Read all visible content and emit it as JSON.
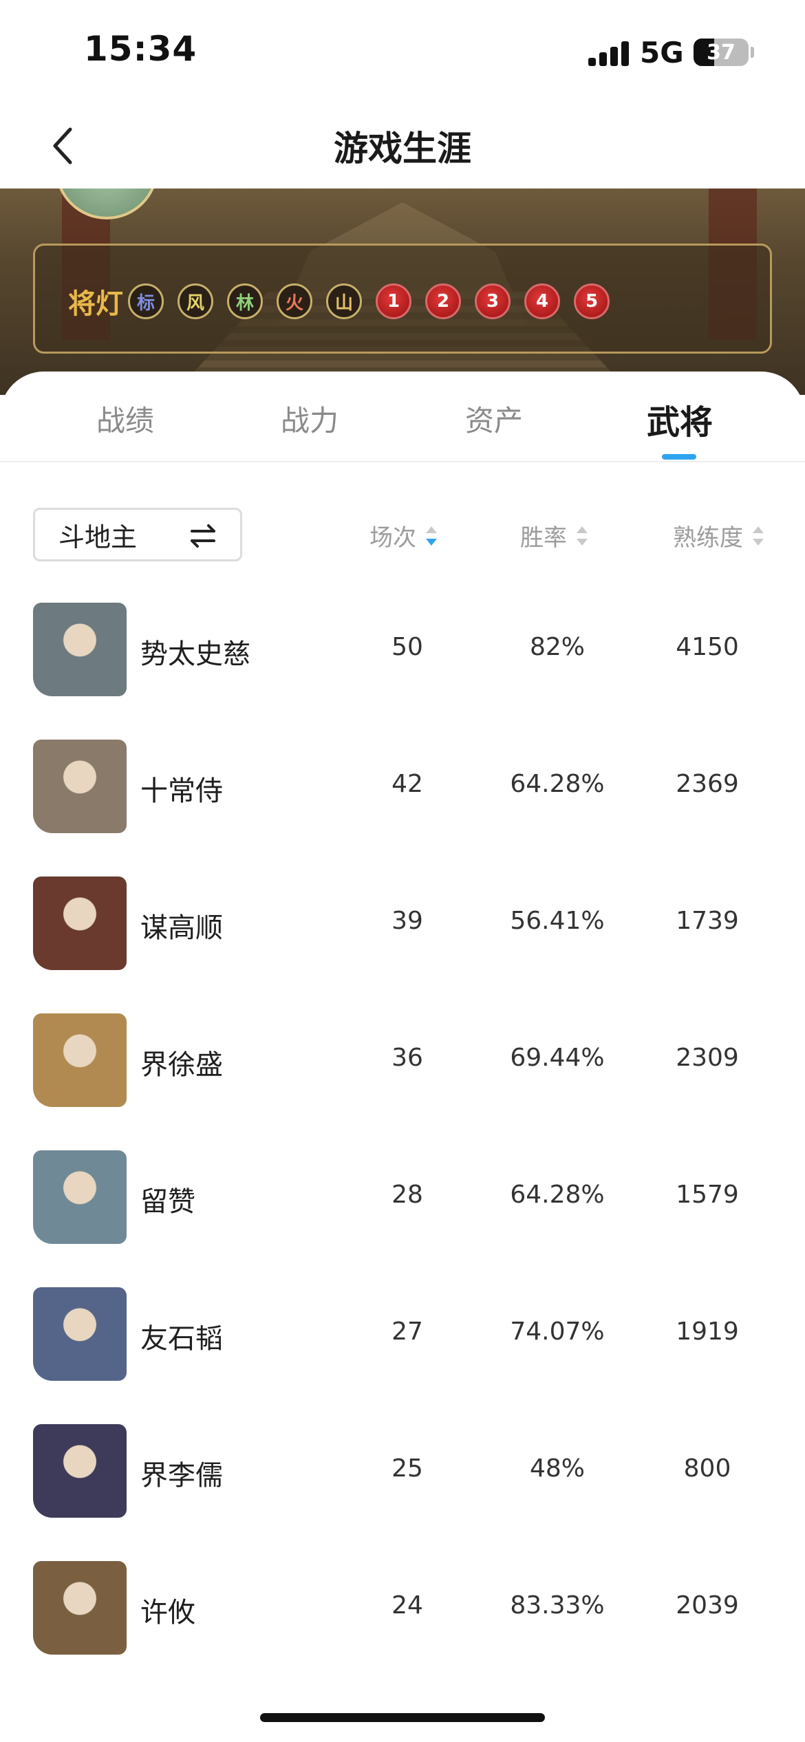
{
  "status": {
    "time": "15:34",
    "network": "5G",
    "battery": "37",
    "battery_level": 0.37
  },
  "nav": {
    "title": "游戏生涯"
  },
  "lamp": {
    "label": "将灯",
    "char_badges": [
      "标",
      "风",
      "林",
      "火",
      "山"
    ],
    "char_colors": [
      "#7f8fe0",
      "#e6d36a",
      "#8fd17a",
      "#e87a5a",
      "#e6c06a"
    ],
    "num_badges": [
      "1",
      "2",
      "3",
      "4",
      "5"
    ]
  },
  "tabs": [
    "战绩",
    "战力",
    "资产",
    "武将"
  ],
  "active_tab": "武将",
  "filter": {
    "label": "斗地主"
  },
  "columns": {
    "games": "场次",
    "rate": "胜率",
    "mastery": "熟练度"
  },
  "heroes": [
    {
      "name": "势太史慈",
      "games": "50",
      "rate": "82%",
      "mastery": "4150",
      "color": "#6d7a80"
    },
    {
      "name": "十常侍",
      "games": "42",
      "rate": "64.28%",
      "mastery": "2369",
      "color": "#8a7a6a"
    },
    {
      "name": "谋高顺",
      "games": "39",
      "rate": "56.41%",
      "mastery": "1739",
      "color": "#6a3a2e"
    },
    {
      "name": "界徐盛",
      "games": "36",
      "rate": "69.44%",
      "mastery": "2309",
      "color": "#b08a50"
    },
    {
      "name": "留赞",
      "games": "28",
      "rate": "64.28%",
      "mastery": "1579",
      "color": "#6f8a96"
    },
    {
      "name": "友石韬",
      "games": "27",
      "rate": "74.07%",
      "mastery": "1919",
      "color": "#55658a"
    },
    {
      "name": "界李儒",
      "games": "25",
      "rate": "48%",
      "mastery": "800",
      "color": "#3d3a5a"
    },
    {
      "name": "许攸",
      "games": "24",
      "rate": "83.33%",
      "mastery": "2039",
      "color": "#7a6040"
    }
  ]
}
